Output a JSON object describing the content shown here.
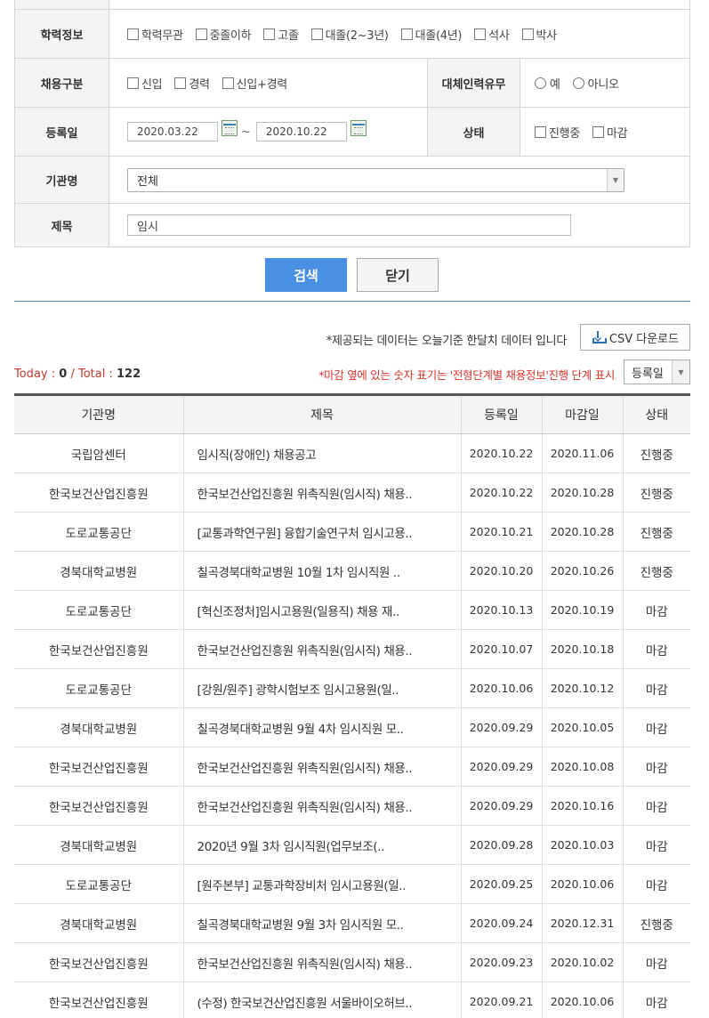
{
  "form": {
    "education": {
      "label": "학력정보",
      "options": [
        "학력무관",
        "중졸이하",
        "고졸",
        "대졸(2~3년)",
        "대졸(4년)",
        "석사",
        "박사"
      ]
    },
    "employment": {
      "label": "채용구분",
      "options": [
        "신입",
        "경력",
        "신입+경력"
      ]
    },
    "substitute": {
      "label": "대체인력유무",
      "options": [
        "예",
        "아니오"
      ]
    },
    "reg_date": {
      "label": "등록일",
      "from": "2020.03.22",
      "tilde": "~",
      "to": "2020.10.22"
    },
    "status": {
      "label": "상태",
      "options": [
        "진행중",
        "마감"
      ]
    },
    "org": {
      "label": "기관명",
      "value": "전체",
      "arrow": "▼"
    },
    "subject": {
      "label": "제목",
      "value": "임시"
    },
    "search_button": "검색",
    "close_button": "닫기"
  },
  "notice": "*제공되는 데이터는 오늘기준 한달치 데이터 입니다",
  "csv_button": "CSV 다운로드",
  "counts": {
    "today_label": "Today",
    "sep1": " : ",
    "today": "0",
    "slash": " / ",
    "total_label": "Total",
    "sep2": " : ",
    "total": "122"
  },
  "stage_note": "*마감 옆에 있는 숫자 표기는 '전형단계별 채용정보'진행 단계 표시",
  "sort": {
    "value": "등록일",
    "arrow": "▼"
  },
  "table": {
    "headers": [
      "기관명",
      "제목",
      "등록일",
      "마감일",
      "상태"
    ],
    "rows": [
      {
        "org": "국립암센터",
        "title": "임시직(장애인) 채용공고",
        "reg": "2020.10.22",
        "due": "2020.11.06",
        "status": "진행중"
      },
      {
        "org": "한국보건산업진흥원",
        "title": "한국보건산업진흥원 위촉직원(임시직) 채용..",
        "reg": "2020.10.22",
        "due": "2020.10.28",
        "status": "진행중"
      },
      {
        "org": "도로교통공단",
        "title": "[교통과학연구원] 융합기술연구처 임시고용..",
        "reg": "2020.10.21",
        "due": "2020.10.28",
        "status": "진행중"
      },
      {
        "org": "경북대학교병원",
        "title": "칠곡경북대학교병원 10월 1차 임시직원 ..",
        "reg": "2020.10.20",
        "due": "2020.10.26",
        "status": "진행중"
      },
      {
        "org": "도로교통공단",
        "title": "[혁신조정처]임시고용원(일용직) 채용 재..",
        "reg": "2020.10.13",
        "due": "2020.10.19",
        "status": "마감"
      },
      {
        "org": "한국보건산업진흥원",
        "title": "한국보건산업진흥원 위촉직원(임시직) 채용..",
        "reg": "2020.10.07",
        "due": "2020.10.18",
        "status": "마감"
      },
      {
        "org": "도로교통공단",
        "title": "[강원/원주] 광학시험보조 임시고용원(일..",
        "reg": "2020.10.06",
        "due": "2020.10.12",
        "status": "마감"
      },
      {
        "org": "경북대학교병원",
        "title": "칠곡경북대학교병원 9월 4차 임시직원 모..",
        "reg": "2020.09.29",
        "due": "2020.10.05",
        "status": "마감"
      },
      {
        "org": "한국보건산업진흥원",
        "title": "한국보건산업진흥원 위촉직원(임시직) 채용..",
        "reg": "2020.09.29",
        "due": "2020.10.08",
        "status": "마감"
      },
      {
        "org": "한국보건산업진흥원",
        "title": "한국보건산업진흥원 위촉직원(임시직) 채용..",
        "reg": "2020.09.29",
        "due": "2020.10.16",
        "status": "마감"
      },
      {
        "org": "경북대학교병원",
        "title": "2020년 9월 3차 임시직원(업무보조(..",
        "reg": "2020.09.28",
        "due": "2020.10.03",
        "status": "마감"
      },
      {
        "org": "도로교통공단",
        "title": "[원주본부] 교통과학장비처 임시고용원(일..",
        "reg": "2020.09.25",
        "due": "2020.10.06",
        "status": "마감"
      },
      {
        "org": "경북대학교병원",
        "title": "칠곡경북대학교병원 9월 3차 임시직원 모..",
        "reg": "2020.09.24",
        "due": "2020.12.31",
        "status": "진행중"
      },
      {
        "org": "한국보건산업진흥원",
        "title": "한국보건산업진흥원 위촉직원(임시직) 채용..",
        "reg": "2020.09.23",
        "due": "2020.10.02",
        "status": "마감"
      },
      {
        "org": "한국보건산업진흥원",
        "title": "(수정) 한국보건산업진흥원 서울바이오허브..",
        "reg": "2020.09.21",
        "due": "2020.10.06",
        "status": "마감"
      }
    ]
  }
}
